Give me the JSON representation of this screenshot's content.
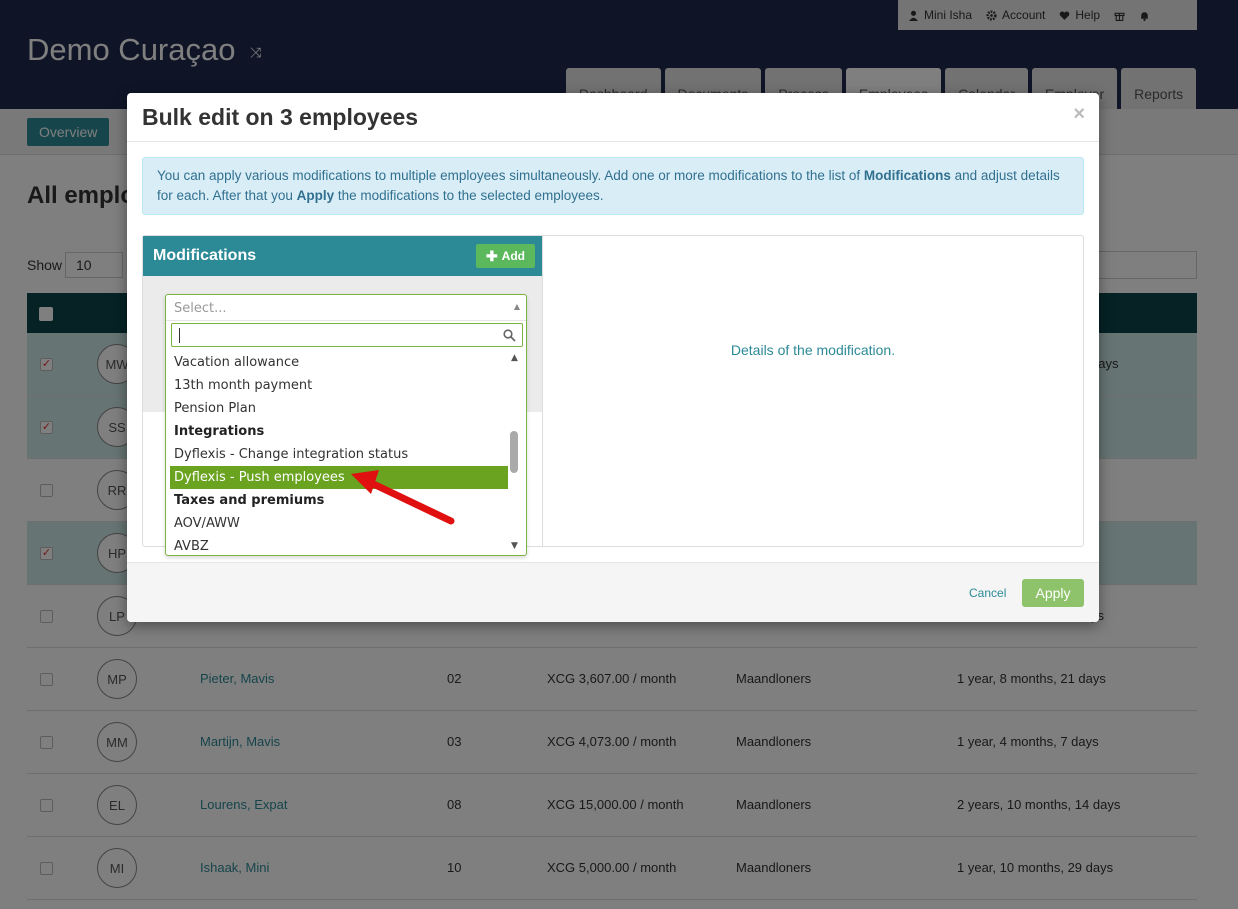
{
  "app": {
    "title": "Demo Curaçao"
  },
  "userbar": {
    "user": "Mini Isha",
    "account": "Account",
    "help": "Help"
  },
  "nav": {
    "tabs": [
      "Dashboard",
      "Documents",
      "Process",
      "Employees",
      "Calendar",
      "Employer",
      "Reports"
    ],
    "active": "Employees"
  },
  "subnav": {
    "overview": "Overview"
  },
  "page": {
    "heading": "All emplo",
    "show_label": "Show",
    "show_value": "10"
  },
  "table": {
    "rows": [
      {
        "initials": "MW",
        "selected": true,
        "name": "",
        "code": "",
        "salary": "",
        "group": "",
        "duration": "days"
      },
      {
        "initials": "SS",
        "selected": true,
        "name": "",
        "code": "",
        "salary": "",
        "group": "",
        "duration": ""
      },
      {
        "initials": "RR",
        "selected": false,
        "name": "",
        "code": "",
        "salary": "",
        "group": "",
        "duration": ""
      },
      {
        "initials": "HP",
        "selected": true,
        "name": "",
        "code": "",
        "salary": "",
        "group": "",
        "duration": ""
      },
      {
        "initials": "LP",
        "selected": false,
        "name": "",
        "code": "",
        "salary": "",
        "group": "",
        "duration": "ys"
      },
      {
        "initials": "MP",
        "selected": false,
        "name": "Pieter, Mavis",
        "code": "02",
        "salary": "XCG 3,607.00 / month",
        "group": "Maandloners",
        "duration": "1 year, 8 months, 21 days"
      },
      {
        "initials": "MM",
        "selected": false,
        "name": "Martijn, Mavis",
        "code": "03",
        "salary": "XCG 4,073.00 / month",
        "group": "Maandloners",
        "duration": "1 year, 4 months, 7 days"
      },
      {
        "initials": "EL",
        "selected": false,
        "name": "Lourens, Expat",
        "code": "08",
        "salary": "XCG 15,000.00 / month",
        "group": "Maandloners",
        "duration": "2 years, 10 months, 14 days"
      },
      {
        "initials": "MI",
        "selected": false,
        "name": "Ishaak, Mini",
        "code": "10",
        "salary": "XCG 5,000.00 / month",
        "group": "Maandloners",
        "duration": "1 year, 10 months, 29 days"
      }
    ]
  },
  "modal": {
    "title": "Bulk edit on 3 employees",
    "close": "×",
    "info_pre": "You can apply various modifications to multiple employees simultaneously. Add one or more modifications to the list of ",
    "info_b1": "Modifications",
    "info_mid": " and adjust details for each. After that you ",
    "info_b2": "Apply",
    "info_post": " the modifications to the selected employees.",
    "mods_title": "Modifications",
    "add_label": "Add",
    "details_text": "Details of the modification.",
    "cancel_label": "Cancel",
    "apply_label": "Apply"
  },
  "dropdown": {
    "placeholder": "Select...",
    "search_value": "",
    "items": [
      {
        "label": "Vacation allowance",
        "type": "option"
      },
      {
        "label": "13th month payment",
        "type": "option"
      },
      {
        "label": "Pension Plan",
        "type": "option"
      },
      {
        "label": "Integrations",
        "type": "group"
      },
      {
        "label": "Dyflexis - Change integration status",
        "type": "option"
      },
      {
        "label": "Dyflexis - Push employees",
        "type": "highlighted"
      },
      {
        "label": "Taxes and premiums",
        "type": "group"
      },
      {
        "label": "AOV/AWW",
        "type": "option"
      },
      {
        "label": "AVBZ",
        "type": "option"
      }
    ]
  },
  "colors": {
    "accent": "#2c8a97",
    "highlight": "#6aa320",
    "apply": "#8fc36b",
    "arrow": "#e01010"
  }
}
